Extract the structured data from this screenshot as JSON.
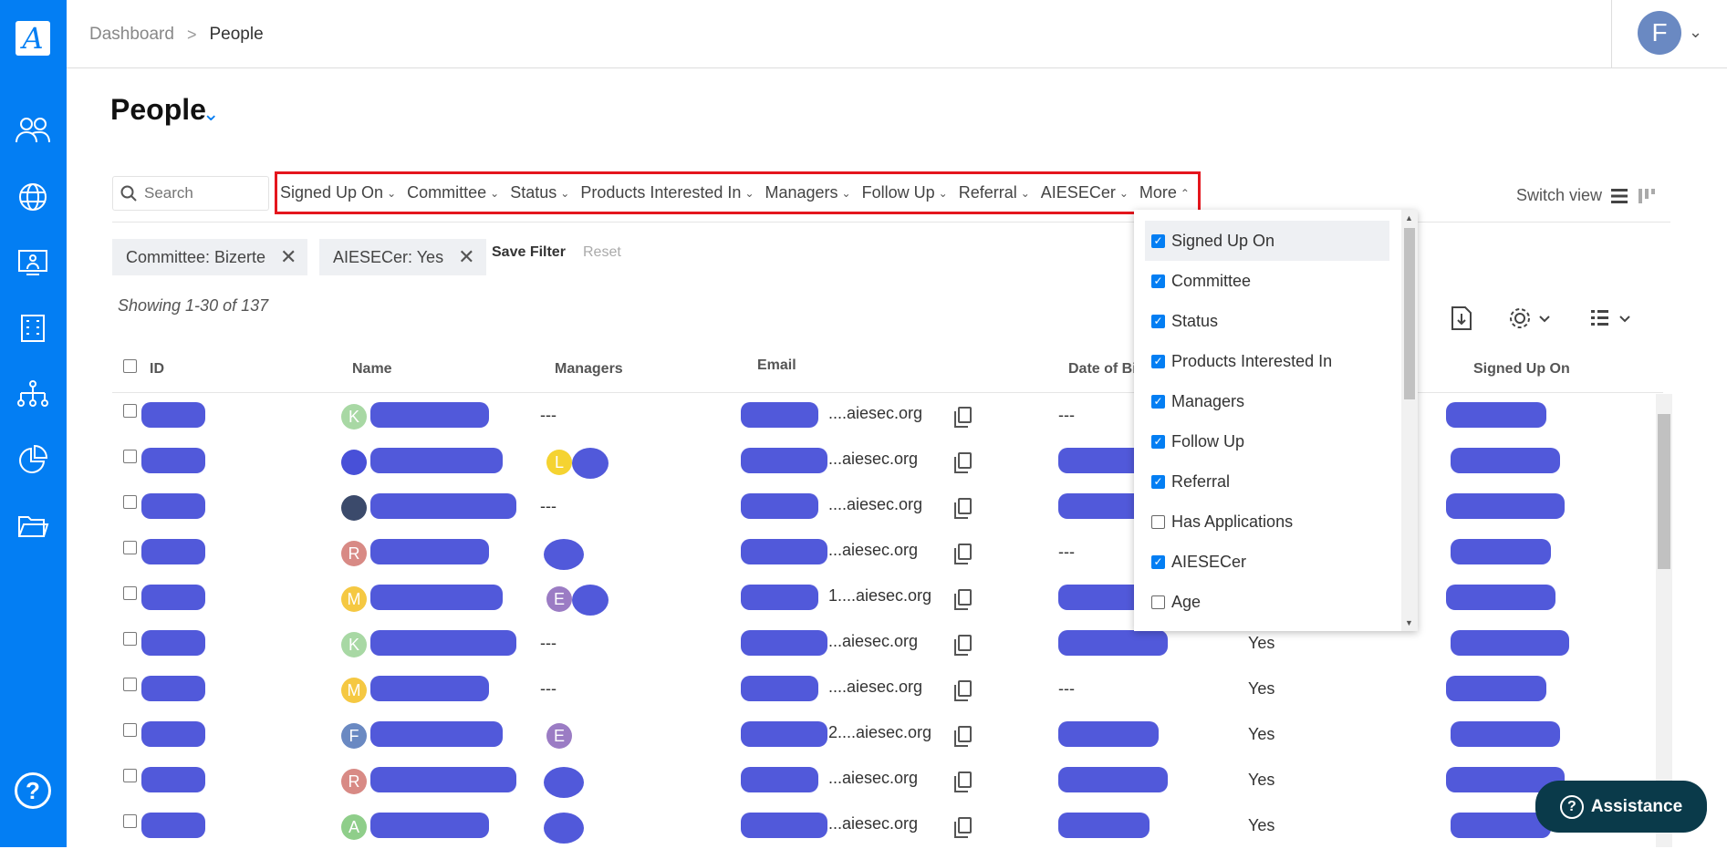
{
  "app": {
    "logo_letter": "A"
  },
  "breadcrumb": {
    "root": "Dashboard",
    "separator": ">",
    "current": "People"
  },
  "user": {
    "initial": "F"
  },
  "page": {
    "title": "People"
  },
  "search": {
    "placeholder": "Search"
  },
  "filters": [
    "Signed Up On",
    "Committee",
    "Status",
    "Products Interested In",
    "Managers",
    "Follow Up",
    "Referral",
    "AIESECer",
    "More"
  ],
  "switch_view": {
    "label": "Switch view"
  },
  "active_filters": [
    {
      "label": "Committee: Bizerte"
    },
    {
      "label": "AIESECer: Yes"
    }
  ],
  "filter_actions": {
    "save": "Save Filter",
    "reset": "Reset"
  },
  "showing": "Showing  1-30 of 137",
  "table": {
    "headers": {
      "id": "ID",
      "name": "Name",
      "managers": "Managers",
      "email": "Email",
      "dob": "Date of Bi",
      "signed_up": "Signed Up On"
    },
    "rows": [
      {
        "avatar": "K",
        "avatar_color": "#a8d8a4",
        "manager": "---",
        "mgr_avatar": "",
        "mgr_color": "",
        "email": "....aiesec.org",
        "dob": "---",
        "aiesecer": ""
      },
      {
        "avatar": "",
        "avatar_color": "#4850d8",
        "manager": "",
        "mgr_avatar": "L",
        "mgr_color": "#f5d331",
        "email": "...aiesec.org",
        "dob": "",
        "aiesecer": ""
      },
      {
        "avatar": "",
        "avatar_color": "#3b4a6b",
        "manager": "---",
        "mgr_avatar": "",
        "mgr_color": "",
        "email": "....aiesec.org",
        "dob": "",
        "aiesecer": ""
      },
      {
        "avatar": "R",
        "avatar_color": "#d88a85",
        "manager": "",
        "mgr_avatar": "",
        "mgr_color": "",
        "email": "...aiesec.org",
        "dob": "---",
        "aiesecer": ""
      },
      {
        "avatar": "M",
        "avatar_color": "#f5c842",
        "manager": "",
        "mgr_avatar": "E",
        "mgr_color": "#9b7cc4",
        "email": "1....aiesec.org",
        "dob": "",
        "aiesecer": ""
      },
      {
        "avatar": "K",
        "avatar_color": "#a8d8a4",
        "manager": "---",
        "mgr_avatar": "",
        "mgr_color": "",
        "email": "...aiesec.org",
        "dob": "",
        "aiesecer": "Yes"
      },
      {
        "avatar": "M",
        "avatar_color": "#f5c842",
        "manager": "---",
        "mgr_avatar": "",
        "mgr_color": "",
        "email": "....aiesec.org",
        "dob": "---",
        "aiesecer": "Yes"
      },
      {
        "avatar": "F",
        "avatar_color": "#6a89c2",
        "manager": "",
        "mgr_avatar": "E",
        "mgr_color": "#9b7cc4",
        "email": "2....aiesec.org",
        "dob": "",
        "aiesecer": "Yes"
      },
      {
        "avatar": "R",
        "avatar_color": "#d88a85",
        "manager": "",
        "mgr_avatar": "",
        "mgr_color": "",
        "email": "...aiesec.org",
        "dob": "",
        "aiesecer": "Yes"
      },
      {
        "avatar": "A",
        "avatar_color": "#8fce8a",
        "manager": "",
        "mgr_avatar": "",
        "mgr_color": "",
        "email": "...aiesec.org",
        "dob": "",
        "aiesecer": "Yes"
      }
    ]
  },
  "columns_menu": [
    {
      "label": "Signed Up On",
      "checked": true
    },
    {
      "label": "Committee",
      "checked": true
    },
    {
      "label": "Status",
      "checked": true
    },
    {
      "label": "Products Interested In",
      "checked": true
    },
    {
      "label": "Managers",
      "checked": true
    },
    {
      "label": "Follow Up",
      "checked": true
    },
    {
      "label": "Referral",
      "checked": true
    },
    {
      "label": "Has Applications",
      "checked": false
    },
    {
      "label": "AIESECer",
      "checked": true
    },
    {
      "label": "Age",
      "checked": false
    }
  ],
  "assistance": {
    "label": "Assistance"
  },
  "colors": {
    "brand": "#037ef3",
    "highlight_border": "#e4161d",
    "redaction": "#4850d8"
  }
}
